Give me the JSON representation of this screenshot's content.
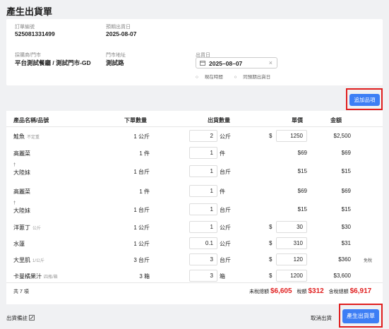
{
  "page": {
    "title": "產生出貨單"
  },
  "order": {
    "order_no_label": "訂單編號",
    "order_no": "525081331499",
    "exp_date_label": "預期出貨日",
    "exp_date": "2025-08-07",
    "store_label": "採購商/門市",
    "store": "平台測試餐廳 / 測試門市-GD",
    "addr_label": "門市地址",
    "addr": "測試路",
    "ship_label": "出貨日",
    "ship_date": "2025–08–07",
    "opt_now": "現在時間",
    "opt_same": "同預期出貨日"
  },
  "actions": {
    "add_item": "追加品項",
    "cancel": "取消出貨",
    "create": "產生出貨單",
    "note": "出貨備註"
  },
  "table": {
    "headers": {
      "name": "產品名稱/品號",
      "order_qty": "下單數量",
      "ship_qty": "出貨數量",
      "price": "單價",
      "amount": "金額"
    },
    "rows": [
      {
        "name": "鮭魚",
        "sub": "不定重",
        "order_qty": "1 公斤",
        "qty": "2",
        "unit": "公斤",
        "price": "1250",
        "amount": "$2,500",
        "extra": ""
      },
      {
        "name": "高麗菜",
        "sub": "",
        "order_qty": "1 件",
        "qty": "1",
        "unit": "件",
        "price": "$69",
        "amount": "$69",
        "extra": ""
      },
      {
        "name": "大陸妹",
        "sub": "",
        "order_qty": "1 台斤",
        "qty": "1",
        "unit": "台斤",
        "price": "$15",
        "amount": "$15",
        "extra": ""
      },
      {
        "name": "高麗菜",
        "sub": "",
        "order_qty": "1 件",
        "qty": "1",
        "unit": "件",
        "price": "$69",
        "amount": "$69",
        "extra": ""
      },
      {
        "name": "大陸妹",
        "sub": "",
        "order_qty": "1 台斤",
        "qty": "1",
        "unit": "台斤",
        "price": "$15",
        "amount": "$15",
        "extra": ""
      },
      {
        "name": "洋蔥丁",
        "sub": "公斤",
        "order_qty": "1 公斤",
        "qty": "1",
        "unit": "公斤",
        "price": "30",
        "amount": "$30",
        "extra": ""
      },
      {
        "name": "水蓮",
        "sub": "",
        "order_qty": "1 公斤",
        "qty": "0.1",
        "unit": "公斤",
        "price": "310",
        "amount": "$31",
        "extra": ""
      },
      {
        "name": "大里肌",
        "sub": "1/公斤",
        "order_qty": "3 台斤",
        "qty": "3",
        "unit": "台斤",
        "price": "120",
        "amount": "$360",
        "extra": "免稅"
      },
      {
        "name": "卡曼橘果汁",
        "sub": "四瓶/箱",
        "order_qty": "3 箱",
        "qty": "3",
        "unit": "箱",
        "price": "1200",
        "amount": "$3,600",
        "extra": ""
      }
    ],
    "dollar": "$",
    "dagger": "†"
  },
  "footer": {
    "count": "共 7 項",
    "pretax_label": "未稅總額",
    "pretax": "$6,605",
    "tax_label": "稅額",
    "tax": "$312",
    "total_label": "含稅總額",
    "total": "$6,917"
  },
  "icons": {
    "calendar": "calendar-icon",
    "clear": "clear-icon",
    "edit": "edit-icon",
    "radio": "radio-icon"
  },
  "colors": {
    "primary": "#3d7ef5",
    "highlight": "#e01e1e"
  }
}
